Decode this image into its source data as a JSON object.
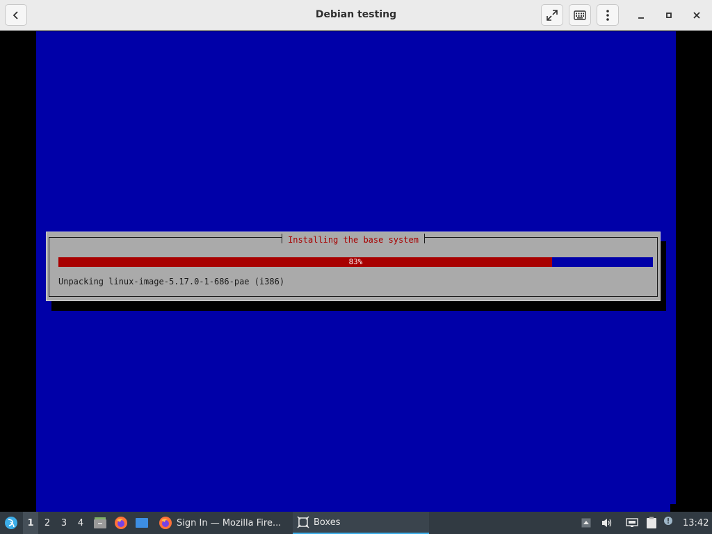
{
  "header": {
    "title": "Debian testing",
    "back_icon": "chevron-left-icon",
    "fullscreen_icon": "fullscreen-icon",
    "keyboard_icon": "keyboard-icon",
    "menu_icon": "kebab-menu-icon",
    "minimize_icon": "minimize-icon",
    "maximize_icon": "maximize-icon",
    "close_icon": "close-icon"
  },
  "installer": {
    "title": "Installing the base system",
    "progress_percent": 83,
    "progress_label": "83%",
    "status": "Unpacking linux-image-5.17.0-1-686-pae (i386)",
    "colors": {
      "background": "#0000a8",
      "dialog": "#aaaaaa",
      "progress_fill": "#a80000",
      "title_text": "#a80000"
    }
  },
  "taskbar": {
    "launcher_icon": "app-launcher-icon",
    "workspaces": [
      "1",
      "2",
      "3",
      "4"
    ],
    "active_workspace": "1",
    "pinned": [
      "files-icon",
      "firefox-icon",
      "desktop-icon"
    ],
    "tasks": [
      {
        "label": "Sign In — Mozilla Fire...",
        "icon": "firefox-icon",
        "active": false
      },
      {
        "label": "Boxes",
        "icon": "boxes-icon",
        "active": true
      }
    ],
    "tray": [
      "tray-arrow-icon",
      "volume-icon",
      "network-icon",
      "clipboard-icon",
      "notification-icon"
    ],
    "clock": "13:42"
  }
}
